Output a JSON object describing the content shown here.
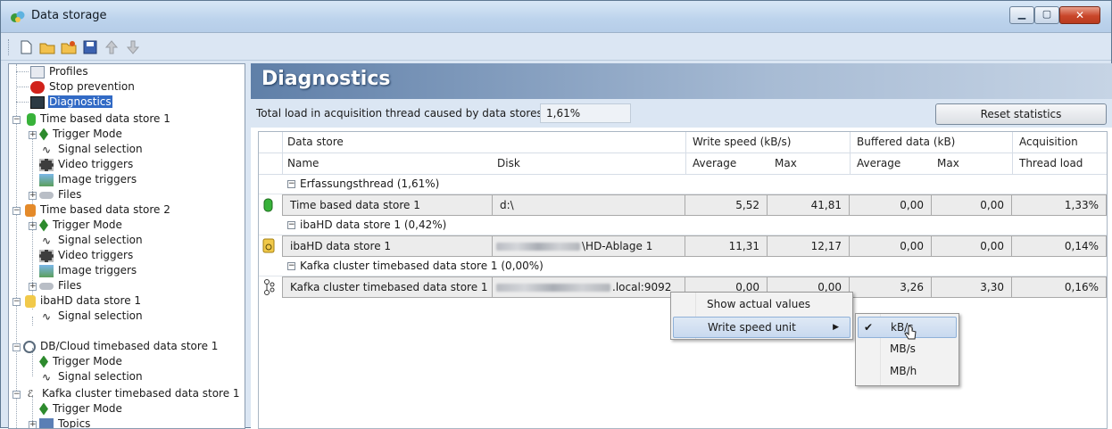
{
  "window": {
    "title": "Data storage"
  },
  "toolbar": {
    "buttons": [
      "new-icon",
      "open-icon",
      "open-special-icon",
      "save-icon",
      "move-up-icon",
      "move-down-icon"
    ]
  },
  "tree": {
    "items": [
      {
        "label": "Profiles"
      },
      {
        "label": "Stop prevention"
      },
      {
        "label": "Diagnostics"
      },
      {
        "label": "Time based data store 1"
      },
      {
        "label": "Trigger Mode"
      },
      {
        "label": "Signal selection"
      },
      {
        "label": "Video triggers"
      },
      {
        "label": "Image triggers"
      },
      {
        "label": "Files"
      },
      {
        "label": "Time based data store 2"
      },
      {
        "label": "Trigger Mode"
      },
      {
        "label": "Signal selection"
      },
      {
        "label": "Video triggers"
      },
      {
        "label": "Image triggers"
      },
      {
        "label": "Files"
      },
      {
        "label": "ibaHD data store 1"
      },
      {
        "label": "Signal selection"
      },
      {
        "label": "DB/Cloud timebased data store 1"
      },
      {
        "label": "Trigger Mode"
      },
      {
        "label": "Signal selection"
      },
      {
        "label": "Kafka cluster timebased data store 1"
      },
      {
        "label": "Trigger Mode"
      },
      {
        "label": "Topics"
      }
    ]
  },
  "main": {
    "title": "Diagnostics",
    "load_label": "Total load in acquisition thread caused by data stores:",
    "load_value": "1,61%",
    "reset_button": "Reset statistics",
    "headers": {
      "data_store": "Data store",
      "write_speed": "Write speed (kB/s)",
      "buffered": "Buffered data (kB)",
      "acquisition": "Acquisition",
      "name": "Name",
      "disk": "Disk",
      "ws_avg": "Average",
      "ws_max": "Max",
      "bd_avg": "Average",
      "bd_max": "Max",
      "thread_load": "Thread load"
    },
    "groups": [
      {
        "label": "Erfassungsthread (1,61%)",
        "row": {
          "name": "Time based data store 1",
          "disk": "d:\\",
          "ws_avg": "5,52",
          "ws_max": "41,81",
          "bd_avg": "0,00",
          "bd_max": "0,00",
          "load": "1,33%"
        }
      },
      {
        "label": "ibaHD data store 1 (0,42%)",
        "row": {
          "name": "ibaHD data store 1",
          "disk": "\\HD-Ablage 1",
          "ws_avg": "11,31",
          "ws_max": "12,17",
          "bd_avg": "0,00",
          "bd_max": "0,00",
          "load": "0,14%"
        }
      },
      {
        "label": "Kafka cluster timebased data store 1 (0,00%)",
        "row": {
          "name": "Kafka cluster timebased data store 1",
          "disk": ".local:9092",
          "ws_avg": "0,00",
          "ws_max": "0,00",
          "bd_avg": "3,26",
          "bd_max": "3,30",
          "load": "0,16%"
        }
      }
    ]
  },
  "context_menu": {
    "items": [
      "Show actual values",
      "Write speed unit"
    ],
    "submenu": [
      "kB/s",
      "MB/s",
      "MB/h"
    ],
    "checked": "kB/s"
  }
}
